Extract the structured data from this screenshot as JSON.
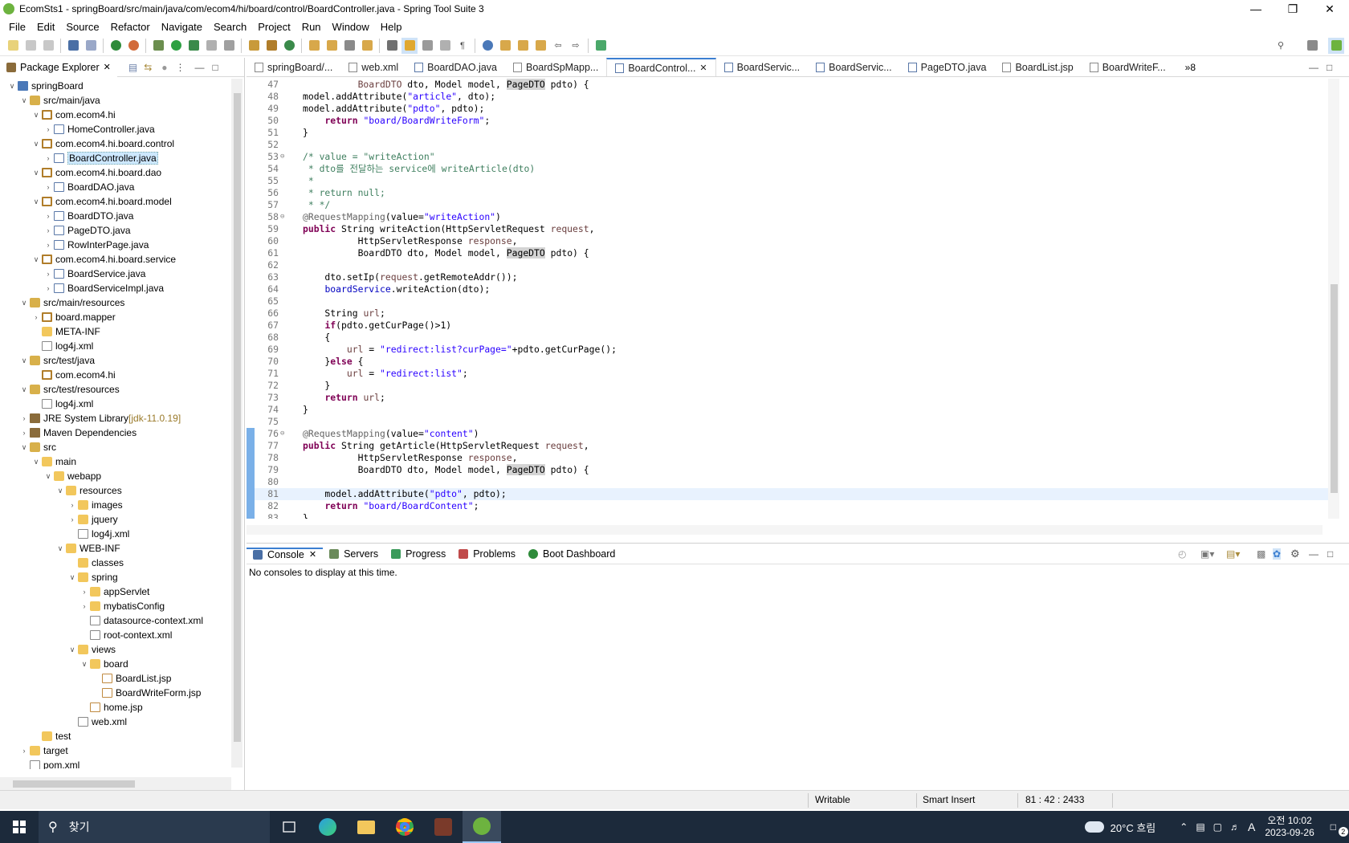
{
  "window": {
    "title": "EcomSts1 - springBoard/src/main/java/com/ecom4/hi/board/control/BoardController.java - Spring Tool Suite 3"
  },
  "menu": [
    "File",
    "Edit",
    "Source",
    "Refactor",
    "Navigate",
    "Search",
    "Project",
    "Run",
    "Window",
    "Help"
  ],
  "left_panel": {
    "tab_label": "Package Explorer"
  },
  "tree": [
    {
      "label": "springBoard",
      "depth": 0,
      "arrow": "v",
      "icon": "proj"
    },
    {
      "label": "src/main/java",
      "depth": 1,
      "arrow": "v",
      "icon": "srcf"
    },
    {
      "label": "com.ecom4.hi",
      "depth": 2,
      "arrow": "v",
      "icon": "pkg"
    },
    {
      "label": "HomeController.java",
      "depth": 3,
      "arrow": ">",
      "icon": "java"
    },
    {
      "label": "com.ecom4.hi.board.control",
      "depth": 2,
      "arrow": "v",
      "icon": "pkg"
    },
    {
      "label": "BoardController.java",
      "depth": 3,
      "arrow": ">",
      "icon": "java",
      "selected": true
    },
    {
      "label": "com.ecom4.hi.board.dao",
      "depth": 2,
      "arrow": "v",
      "icon": "pkg"
    },
    {
      "label": "BoardDAO.java",
      "depth": 3,
      "arrow": ">",
      "icon": "java"
    },
    {
      "label": "com.ecom4.hi.board.model",
      "depth": 2,
      "arrow": "v",
      "icon": "pkg"
    },
    {
      "label": "BoardDTO.java",
      "depth": 3,
      "arrow": ">",
      "icon": "java"
    },
    {
      "label": "PageDTO.java",
      "depth": 3,
      "arrow": ">",
      "icon": "java"
    },
    {
      "label": "RowInterPage.java",
      "depth": 3,
      "arrow": ">",
      "icon": "java"
    },
    {
      "label": "com.ecom4.hi.board.service",
      "depth": 2,
      "arrow": "v",
      "icon": "pkg"
    },
    {
      "label": "BoardService.java",
      "depth": 3,
      "arrow": ">",
      "icon": "java"
    },
    {
      "label": "BoardServiceImpl.java",
      "depth": 3,
      "arrow": ">",
      "icon": "java"
    },
    {
      "label": "src/main/resources",
      "depth": 1,
      "arrow": "v",
      "icon": "srcf"
    },
    {
      "label": "board.mapper",
      "depth": 2,
      "arrow": ">",
      "icon": "pkg"
    },
    {
      "label": "META-INF",
      "depth": 2,
      "arrow": "",
      "icon": "folder"
    },
    {
      "label": "log4j.xml",
      "depth": 2,
      "arrow": "",
      "icon": "xml"
    },
    {
      "label": "src/test/java",
      "depth": 1,
      "arrow": "v",
      "icon": "srcf"
    },
    {
      "label": "com.ecom4.hi",
      "depth": 2,
      "arrow": "",
      "icon": "pkg"
    },
    {
      "label": "src/test/resources",
      "depth": 1,
      "arrow": "v",
      "icon": "srcf"
    },
    {
      "label": "log4j.xml",
      "depth": 2,
      "arrow": "",
      "icon": "xml"
    },
    {
      "label": "JRE System Library",
      "suffix": " [jdk-11.0.19]",
      "depth": 1,
      "arrow": ">",
      "icon": "lib"
    },
    {
      "label": "Maven Dependencies",
      "depth": 1,
      "arrow": ">",
      "icon": "lib"
    },
    {
      "label": "src",
      "depth": 1,
      "arrow": "v",
      "icon": "srcf"
    },
    {
      "label": "main",
      "depth": 2,
      "arrow": "v",
      "icon": "folder"
    },
    {
      "label": "webapp",
      "depth": 3,
      "arrow": "v",
      "icon": "folder"
    },
    {
      "label": "resources",
      "depth": 4,
      "arrow": "v",
      "icon": "folder"
    },
    {
      "label": "images",
      "depth": 5,
      "arrow": ">",
      "icon": "folder"
    },
    {
      "label": "jquery",
      "depth": 5,
      "arrow": ">",
      "icon": "folder"
    },
    {
      "label": "log4j.xml",
      "depth": 5,
      "arrow": "",
      "icon": "xml"
    },
    {
      "label": "WEB-INF",
      "depth": 4,
      "arrow": "v",
      "icon": "folder"
    },
    {
      "label": "classes",
      "depth": 5,
      "arrow": "",
      "icon": "folder"
    },
    {
      "label": "spring",
      "depth": 5,
      "arrow": "v",
      "icon": "folder"
    },
    {
      "label": "appServlet",
      "depth": 6,
      "arrow": ">",
      "icon": "folder"
    },
    {
      "label": "mybatisConfig",
      "depth": 6,
      "arrow": ">",
      "icon": "folder"
    },
    {
      "label": "datasource-context.xml",
      "depth": 6,
      "arrow": "",
      "icon": "xml"
    },
    {
      "label": "root-context.xml",
      "depth": 6,
      "arrow": "",
      "icon": "xml"
    },
    {
      "label": "views",
      "depth": 5,
      "arrow": "v",
      "icon": "folder"
    },
    {
      "label": "board",
      "depth": 6,
      "arrow": "v",
      "icon": "folder"
    },
    {
      "label": "BoardList.jsp",
      "depth": 7,
      "arrow": "",
      "icon": "jsp"
    },
    {
      "label": "BoardWriteForm.jsp",
      "depth": 7,
      "arrow": "",
      "icon": "jsp"
    },
    {
      "label": "home.jsp",
      "depth": 6,
      "arrow": "",
      "icon": "jsp"
    },
    {
      "label": "web.xml",
      "depth": 5,
      "arrow": "",
      "icon": "xml"
    },
    {
      "label": "test",
      "depth": 2,
      "arrow": "",
      "icon": "folder"
    },
    {
      "label": "target",
      "depth": 1,
      "arrow": ">",
      "icon": "folder"
    },
    {
      "label": "pom.xml",
      "depth": 1,
      "arrow": "",
      "icon": "xml"
    }
  ],
  "editor_tabs": [
    {
      "label": "springBoard/...",
      "icon": "x"
    },
    {
      "label": "web.xml",
      "icon": "x"
    },
    {
      "label": "BoardDAO.java",
      "icon": "j"
    },
    {
      "label": "BoardSpMapp...",
      "icon": "x"
    },
    {
      "label": "BoardControl...",
      "icon": "j",
      "active": true
    },
    {
      "label": "BoardServic...",
      "icon": "j"
    },
    {
      "label": "BoardServic...",
      "icon": "j"
    },
    {
      "label": "PageDTO.java",
      "icon": "j"
    },
    {
      "label": "BoardList.jsp",
      "icon": "x"
    },
    {
      "label": "BoardWriteF...",
      "icon": "x"
    }
  ],
  "editor_overflow": "»8",
  "code_lines": [
    {
      "n": "47",
      "html": "          <span class=\"var\">BoardDTO</span> dto, Model model, <span class=\"hl\">PageDTO</span> pdto) {"
    },
    {
      "n": "48",
      "html": "model.addAttribute(<span class=\"str\">\"article\"</span>, dto);"
    },
    {
      "n": "49",
      "html": "model.addAttribute(<span class=\"str\">\"pdto\"</span>, pdto);"
    },
    {
      "n": "50",
      "html": "    <span class=\"kw\">return</span> <span class=\"str\">\"board/BoardWriteForm\"</span>;"
    },
    {
      "n": "51",
      "html": "}"
    },
    {
      "n": "52",
      "html": ""
    },
    {
      "n": "53",
      "fold": "⊖",
      "html": "<span class=\"cm\">/* value = \"writeAction\"</span>"
    },
    {
      "n": "54",
      "html": "<span class=\"cm\"> * dto를 전달하는 service에 writeArticle(dto)</span>"
    },
    {
      "n": "55",
      "html": "<span class=\"cm\"> *</span>"
    },
    {
      "n": "56",
      "html": "<span class=\"cm\"> * return null;</span>"
    },
    {
      "n": "57",
      "html": "<span class=\"cm\"> * */</span>"
    },
    {
      "n": "58",
      "fold": "⊖",
      "html": "<span class=\"an\">@RequestMapping</span>(value=<span class=\"str\">\"writeAction\"</span>)"
    },
    {
      "n": "59",
      "html": "<span class=\"kw\">public</span> String writeAction(HttpServletRequest <span class=\"var\">request</span>,"
    },
    {
      "n": "60",
      "html": "          HttpServletResponse <span class=\"var\">response</span>,"
    },
    {
      "n": "61",
      "html": "          BoardDTO dto, Model model, <span class=\"hl\">PageDTO</span> pdto) {"
    },
    {
      "n": "62",
      "html": ""
    },
    {
      "n": "63",
      "html": "    dto.setIp(<span class=\"var\">request</span>.getRemoteAddr());"
    },
    {
      "n": "64",
      "html": "    <span class=\"fld\">boardService</span>.writeAction(dto);"
    },
    {
      "n": "65",
      "html": ""
    },
    {
      "n": "66",
      "html": "    String <span class=\"var\">url</span>;"
    },
    {
      "n": "67",
      "html": "    <span class=\"kw\">if</span>(pdto.getCurPage()&gt;1)"
    },
    {
      "n": "68",
      "html": "    {"
    },
    {
      "n": "69",
      "html": "        <span class=\"var\">url</span> = <span class=\"str\">\"redirect:list?curPage=\"</span>+pdto.getCurPage();"
    },
    {
      "n": "70",
      "html": "    }<span class=\"kw\">else</span> {"
    },
    {
      "n": "71",
      "html": "        <span class=\"var\">url</span> = <span class=\"str\">\"redirect:list\"</span>;"
    },
    {
      "n": "72",
      "html": "    }"
    },
    {
      "n": "73",
      "html": "    <span class=\"kw\">return</span> <span class=\"var\">url</span>;"
    },
    {
      "n": "74",
      "html": "}"
    },
    {
      "n": "75",
      "html": ""
    },
    {
      "n": "76",
      "fold": "⊖",
      "mark": true,
      "html": "<span class=\"an\">@RequestMapping</span>(value=<span class=\"str\">\"content\"</span>)"
    },
    {
      "n": "77",
      "mark": true,
      "html": "<span class=\"kw\">public</span> String getArticle(HttpServletRequest <span class=\"var\">request</span>,"
    },
    {
      "n": "78",
      "mark": true,
      "html": "          HttpServletResponse <span class=\"var\">response</span>,"
    },
    {
      "n": "79",
      "mark": true,
      "html": "          BoardDTO dto, Model model, <span class=\"hl\">PageDTO</span> pdto) {"
    },
    {
      "n": "80",
      "mark": true,
      "html": ""
    },
    {
      "n": "81",
      "mark": true,
      "cur": true,
      "html": "    model.addAttribute(<span class=\"str\">\"pdto\"</span>, pdto);"
    },
    {
      "n": "82",
      "mark": true,
      "html": "    <span class=\"kw\">return</span> <span class=\"str\">\"board/BoardContent\"</span>;"
    },
    {
      "n": "83",
      "mark": true,
      "html": "}"
    }
  ],
  "console": {
    "tabs": [
      "Console",
      "Servers",
      "Progress",
      "Problems",
      "Boot Dashboard"
    ],
    "message": "No consoles to display at this time."
  },
  "status": {
    "writable": "Writable",
    "insert_mode": "Smart Insert",
    "position": "81 : 42 : 2433"
  },
  "taskbar": {
    "search_label": "찾기",
    "weather": "20°C  흐림",
    "time": "오전 10:02",
    "date": "2023-09-26",
    "ime": "A",
    "notif_count": "2"
  }
}
